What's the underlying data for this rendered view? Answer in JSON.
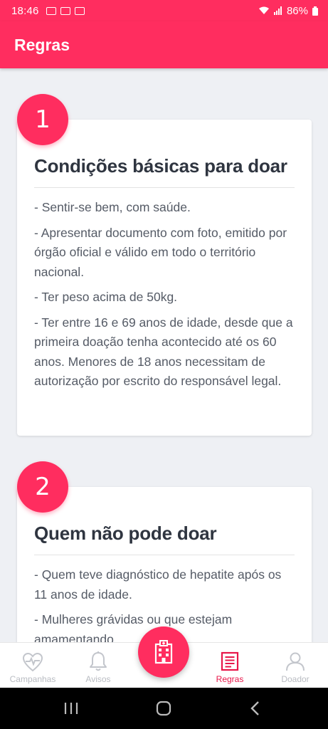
{
  "status_bar": {
    "time": "18:46",
    "battery": "86%"
  },
  "app_bar": {
    "title": "Regras"
  },
  "rules": [
    {
      "number": "1",
      "title": "Condições básicas para doar",
      "items": [
        "- Sentir-se bem, com saúde.",
        "- Apresentar documento com foto, emitido por órgão oficial e válido em todo o território nacional.",
        "- Ter peso acima de 50kg.",
        "- Ter entre 16 e 69 anos de idade, desde que a primeira doação tenha acontecido até os 60 anos. Menores de 18 anos necessitam de autorização por escrito do responsável legal."
      ]
    },
    {
      "number": "2",
      "title": "Quem não pode doar",
      "items": [
        "- Quem teve diagnóstico de hepatite após os 11 anos de idade.",
        "- Mulheres grávidas ou que estejam amamentando."
      ]
    }
  ],
  "bottom_nav": {
    "items": [
      {
        "label": "Campanhas",
        "icon": "heart-pulse-icon"
      },
      {
        "label": "Avisos",
        "icon": "bell-icon"
      },
      {
        "label": "Regras",
        "icon": "document-icon",
        "active": true
      },
      {
        "label": "Doador",
        "icon": "user-icon"
      }
    ],
    "fab_icon": "hospital-icon"
  },
  "colors": {
    "primary": "#ff2d5f",
    "active_label": "#e8174a",
    "inactive_label": "#b9bcc2",
    "background": "#eef0f4"
  }
}
